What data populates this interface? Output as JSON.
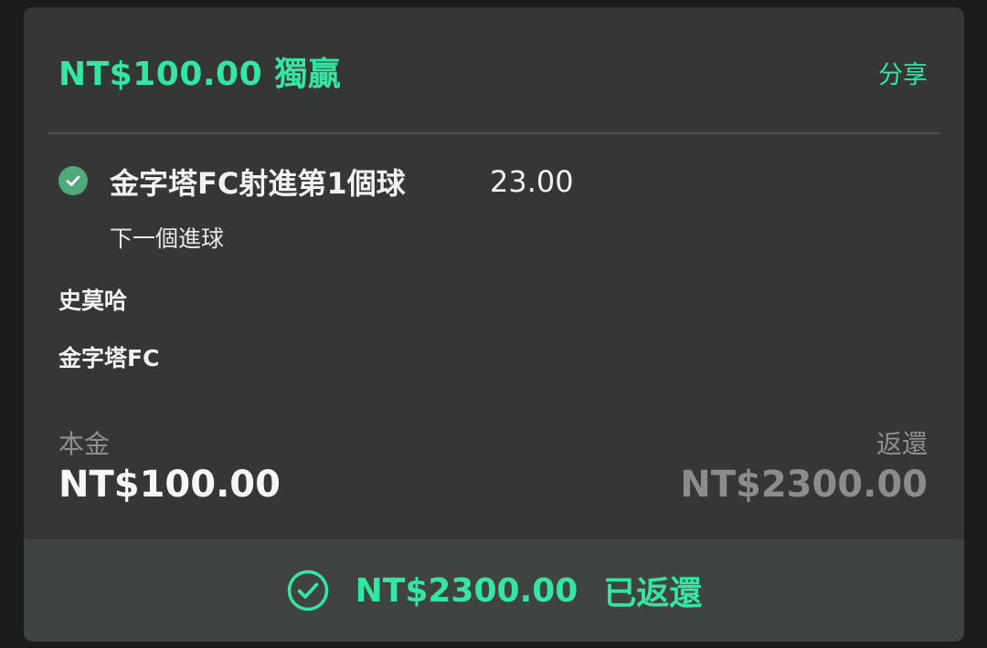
{
  "header": {
    "title": "NT$100.00 獨贏",
    "share_label": "分享"
  },
  "selection": {
    "status_icon": "check-circle-icon",
    "title": "金字塔FC射進第1個球",
    "odds": "23.00",
    "market": "下一個進球"
  },
  "match": {
    "home_team": "史莫哈",
    "away_team": "金字塔FC"
  },
  "stake": {
    "label": "本金",
    "value": "NT$100.00"
  },
  "returns": {
    "label": "返還",
    "value": "NT$2300.00"
  },
  "footer": {
    "icon": "check-circle-outline-icon",
    "amount": "NT$2300.00",
    "status": "已返還"
  },
  "colors": {
    "accent": "#35e6a0",
    "card_bg": "#343736",
    "footer_bg": "#3f4342",
    "check_fill": "#4fa979",
    "muted_text": "#8d908f"
  }
}
